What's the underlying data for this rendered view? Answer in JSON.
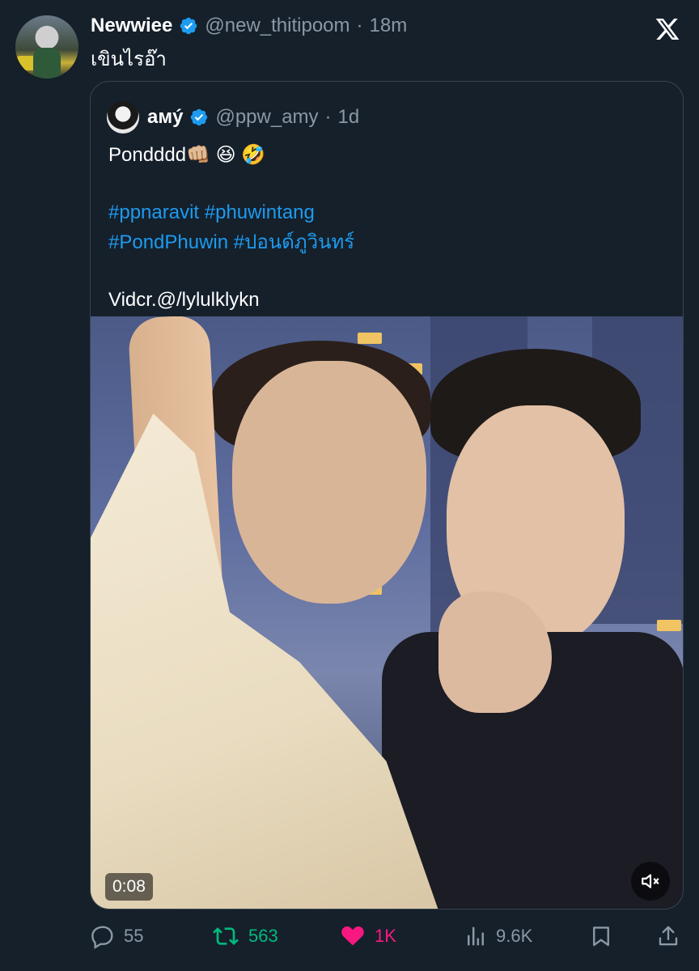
{
  "author": {
    "display_name": "Newwiee",
    "handle": "@new_thitipoom",
    "separator": "·",
    "time": "18m"
  },
  "tweet": {
    "text": "เขินไรอ๊า"
  },
  "quoted": {
    "display_name": "aмý",
    "handle": "@ppw_amy",
    "separator": "·",
    "time": "1d",
    "text_line1": "Pondddd👊🏼 😆 🤣",
    "hashtags_line1": [
      "#ppnaravit",
      "#phuwintang"
    ],
    "hashtags_line2": [
      "#PondPhuwin",
      "#ปอนด์ภูวินทร์"
    ],
    "credit": "Vidcr.@/lylulklykn",
    "media": {
      "duration": "0:08",
      "muted": true
    }
  },
  "actions": {
    "replies": "55",
    "reposts": "563",
    "likes": "1K",
    "views": "9.6K"
  },
  "colors": {
    "background": "#15202b",
    "accent": "#1d9bf0",
    "muted_text": "#8b98a5",
    "repost_active": "#00ba7c",
    "like_active": "#f91880"
  },
  "icons": [
    "verified-badge-icon",
    "x-logo-icon",
    "reply-icon",
    "repost-icon",
    "like-icon",
    "views-icon",
    "bookmark-icon",
    "share-icon",
    "mute-icon"
  ]
}
